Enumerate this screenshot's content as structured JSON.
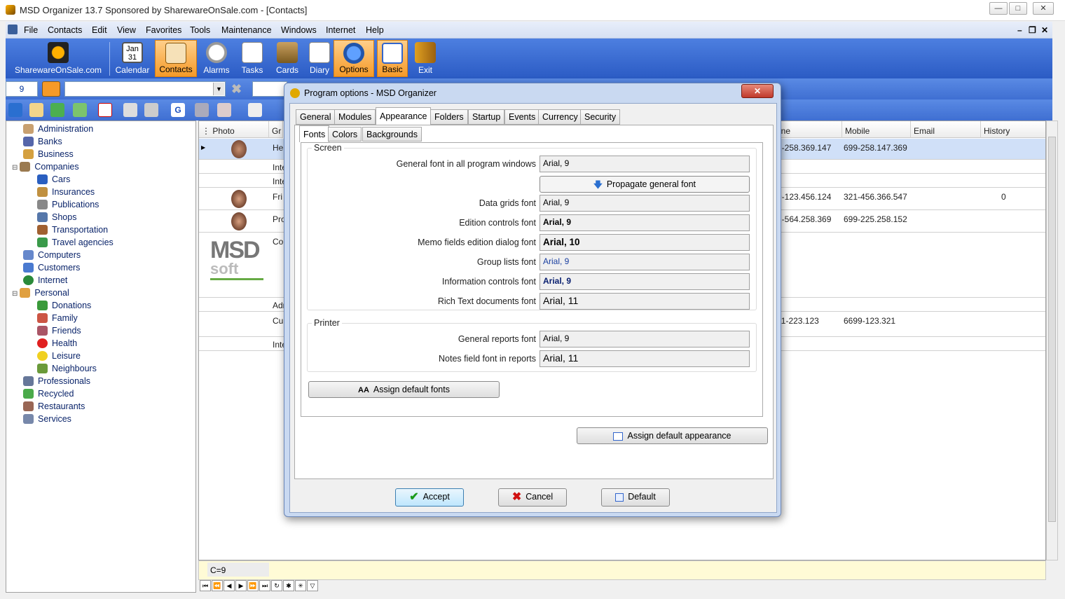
{
  "window": {
    "title": "MSD Organizer 13.7 Sponsored by SharewareOnSale.com - [Contacts]"
  },
  "menu": [
    "File",
    "Contacts",
    "Edit",
    "View",
    "Favorites",
    "Tools",
    "Maintenance",
    "Windows",
    "Internet",
    "Help"
  ],
  "toolbar": {
    "sponsor": "SharewareOnSale.com",
    "calendar": "Calendar",
    "contacts": "Contacts",
    "alarms": "Alarms",
    "tasks": "Tasks",
    "cards": "Cards",
    "diary": "Diary",
    "options": "Options",
    "basic": "Basic",
    "exit": "Exit"
  },
  "record_count": "9",
  "tree": [
    "Administration",
    "Banks",
    "Business",
    "Companies",
    "Cars",
    "Insurances",
    "Publications",
    "Shops",
    "Transportation",
    "Travel agencies",
    "Computers",
    "Customers",
    "Internet",
    "Personal",
    "Donations",
    "Family",
    "Friends",
    "Health",
    "Leisure",
    "Neighbours",
    "Professionals",
    "Recycled",
    "Restaurants",
    "Services"
  ],
  "grid": {
    "headers": {
      "photo": "Photo",
      "group": "Gr",
      "phone": "one",
      "mobile": "Mobile",
      "email": "Email",
      "history": "History"
    },
    "rows": [
      {
        "group": "He",
        "phone": "2-258.369.147",
        "mobile": "699-258.147.369",
        "history": ""
      },
      {
        "group": "Inte",
        "phone": "",
        "mobile": "",
        "history": ""
      },
      {
        "group": "Inte",
        "phone": "",
        "mobile": "",
        "history": ""
      },
      {
        "group": "Fri",
        "phone": "9-123.456.124",
        "mobile": "321-456.366.547",
        "history": "0"
      },
      {
        "group": "Pro",
        "phone": "2-564.258.369",
        "mobile": "699-225.258.152",
        "history": ""
      },
      {
        "group": "Co",
        "phone": "",
        "mobile": "",
        "history": ""
      },
      {
        "group": "Adr",
        "phone": "",
        "mobile": "",
        "history": ""
      },
      {
        "group": "Cu",
        "phone": "11-223.123",
        "mobile": "6699-123.321",
        "history": ""
      },
      {
        "group": "Inte",
        "phone": "",
        "mobile": "",
        "history": ""
      }
    ],
    "logo_text": [
      "MSD",
      "soft"
    ],
    "footer": "C=9"
  },
  "dialog": {
    "title": "Program options - MSD Organizer",
    "tabs": [
      "General",
      "Modules",
      "Appearance",
      "Folders",
      "Startup",
      "Events",
      "Currency",
      "Security"
    ],
    "subtabs": [
      "Fonts",
      "Colors",
      "Backgrounds"
    ],
    "screen_group": "Screen",
    "printer_group": "Printer",
    "fields": {
      "general_label": "General font in all program windows",
      "general_value": "Arial, 9",
      "propagate": "Propagate general font",
      "grids_label": "Data grids font",
      "grids_value": "Arial, 9",
      "edition_label": "Edition controls font",
      "edition_value": "Arial, 9",
      "memo_label": "Memo fields edition dialog font",
      "memo_value": "Arial, 10",
      "group_label": "Group lists font",
      "group_value": "Arial, 9",
      "info_label": "Information controls font",
      "info_value": "Arial, 9",
      "rich_label": "Rich Text documents font",
      "rich_value": "Arial, 11",
      "reports_label": "General reports font",
      "reports_value": "Arial, 9",
      "notes_label": "Notes field font in reports",
      "notes_value": "Arial, 11"
    },
    "assign_fonts": "Assign default fonts",
    "assign_appearance": "Assign default appearance",
    "accept": "Accept",
    "cancel": "Cancel",
    "default": "Default"
  },
  "colors": {
    "accent": "#2b5bc4",
    "selected": "#f59a28",
    "link": "#0a246a"
  }
}
